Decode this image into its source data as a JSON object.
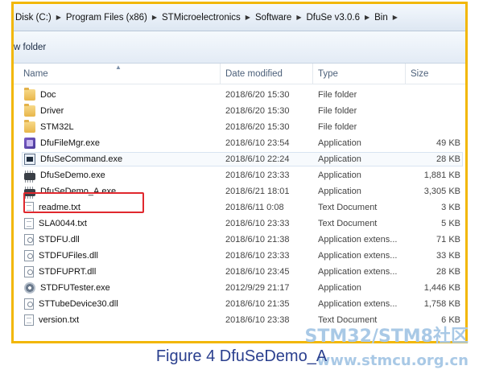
{
  "address_bar": {
    "crumbs": [
      "Disk (C:)",
      "Program Files (x86)",
      "STMicroelectronics",
      "Software",
      "DfuSe v3.0.6",
      "Bin"
    ],
    "separator": "▶"
  },
  "toolbar": {
    "new_folder_label": "w folder"
  },
  "columns": {
    "name": "Name",
    "date": "Date modified",
    "type": "Type",
    "size": "Size",
    "sort_glyph": "▲"
  },
  "files": [
    {
      "name": "Doc",
      "date": "2018/6/20 15:30",
      "type": "File folder",
      "size": "",
      "icon": "folder-icon"
    },
    {
      "name": "Driver",
      "date": "2018/6/20 15:30",
      "type": "File folder",
      "size": "",
      "icon": "folder-icon"
    },
    {
      "name": "STM32L",
      "date": "2018/6/20 15:30",
      "type": "File folder",
      "size": "",
      "icon": "folder-icon"
    },
    {
      "name": "DfuFileMgr.exe",
      "date": "2018/6/10 23:54",
      "type": "Application",
      "size": "49 KB",
      "icon": "app-icon"
    },
    {
      "name": "DfuSeCommand.exe",
      "date": "2018/6/10 22:24",
      "type": "Application",
      "size": "28 KB",
      "icon": "console-icon"
    },
    {
      "name": "DfuSeDemo.exe",
      "date": "2018/6/10 23:33",
      "type": "Application",
      "size": "1,881 KB",
      "icon": "chip-icon"
    },
    {
      "name": "DfuSeDemo_A.exe",
      "date": "2018/6/21 18:01",
      "type": "Application",
      "size": "3,305 KB",
      "icon": "chip-icon"
    },
    {
      "name": "readme.txt",
      "date": "2018/6/11 0:08",
      "type": "Text Document",
      "size": "3 KB",
      "icon": "text-file-icon"
    },
    {
      "name": "SLA0044.txt",
      "date": "2018/6/10 23:33",
      "type": "Text Document",
      "size": "5 KB",
      "icon": "text-file-icon"
    },
    {
      "name": "STDFU.dll",
      "date": "2018/6/10 21:38",
      "type": "Application extens...",
      "size": "71 KB",
      "icon": "dll-icon"
    },
    {
      "name": "STDFUFiles.dll",
      "date": "2018/6/10 23:33",
      "type": "Application extens...",
      "size": "33 KB",
      "icon": "dll-icon"
    },
    {
      "name": "STDFUPRT.dll",
      "date": "2018/6/10 23:45",
      "type": "Application extens...",
      "size": "28 KB",
      "icon": "dll-icon"
    },
    {
      "name": "STDFUTester.exe",
      "date": "2012/9/29 21:17",
      "type": "Application",
      "size": "1,446 KB",
      "icon": "gear-icon"
    },
    {
      "name": "STTubeDevice30.dll",
      "date": "2018/6/10 21:35",
      "type": "Application extens...",
      "size": "1,758 KB",
      "icon": "dll-icon"
    },
    {
      "name": "version.txt",
      "date": "2018/6/10 23:38",
      "type": "Text Document",
      "size": "6 KB",
      "icon": "text-file-icon"
    }
  ],
  "caption": "Figure 4 DfuSeDemo_A",
  "watermark": {
    "line1": "STM32/STM8社区",
    "line2": "www.stmcu.org.cn"
  },
  "colors": {
    "frame": "#f2b705",
    "highlight": "#e0282e",
    "caption": "#2a3f8e",
    "watermark": "#a9c9e6"
  }
}
